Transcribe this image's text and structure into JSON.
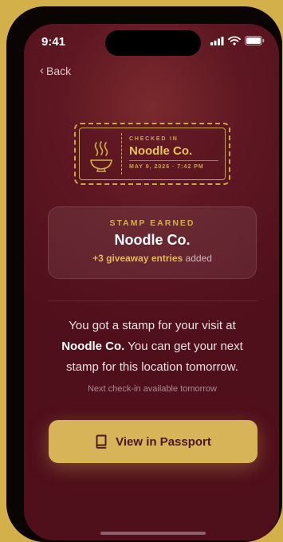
{
  "status_bar": {
    "time": "9:41"
  },
  "nav": {
    "back_label": "Back"
  },
  "ticket": {
    "label": "CHECKED IN",
    "name": "Noodle Co.",
    "date": "MAY 9, 2026 · 7:42 PM",
    "icon": "noodle-bowl-icon"
  },
  "stamp_card": {
    "eyebrow": "STAMP EARNED",
    "title": "Noodle Co.",
    "entries_bold": "+3 giveaway entries",
    "entries_suffix": " added"
  },
  "message": {
    "part1": "You got a stamp for your visit at ",
    "place": "Noodle Co.",
    "part2": " You can get your next stamp for this location tomorrow."
  },
  "next_checkin": "Next check-in available tomorrow",
  "passport_button": {
    "label": "View in Passport",
    "icon": "book-icon"
  },
  "colors": {
    "background": "#5e1722",
    "accent": "#d6b457",
    "frame": "#d4b04a"
  }
}
